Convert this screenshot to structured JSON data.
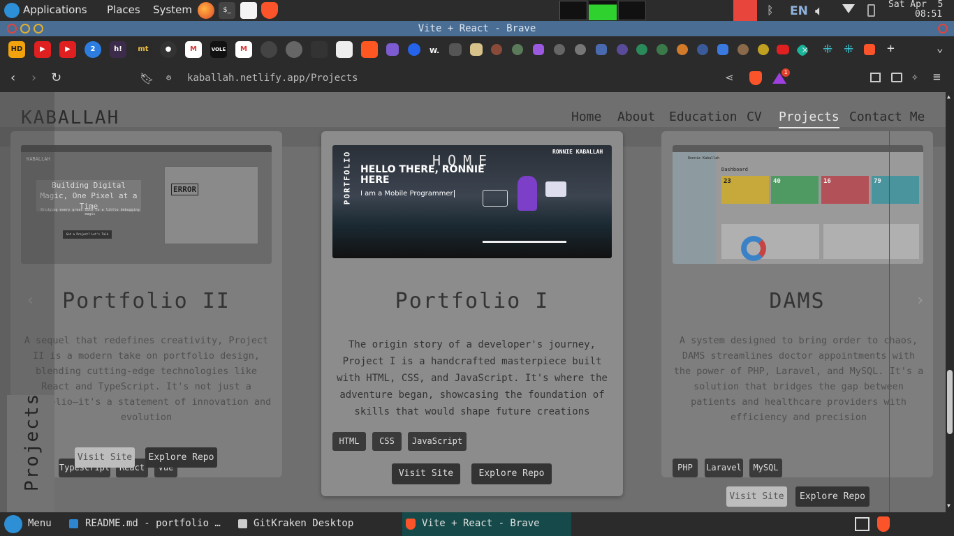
{
  "top_panel": {
    "menus": [
      "Applications",
      "Places",
      "System"
    ],
    "keyboard_layout": "EN",
    "clock_date": "Sat Apr  5",
    "clock_time": "08:51"
  },
  "window": {
    "title": "Vite + React - Brave"
  },
  "tabs": [
    {
      "label": "HD",
      "color": "#f2a20c"
    },
    {
      "label": "",
      "color": "#e02020",
      "icon": "youtube-icon"
    },
    {
      "label": "",
      "color": "#e02020",
      "icon": "youtube-icon"
    },
    {
      "label": "2",
      "color": "#2d7de0"
    },
    {
      "label": "h!",
      "color": "#3c2b4a"
    },
    {
      "label": "mt",
      "color": "#2a2a2a"
    },
    {
      "label": "",
      "color": "#333",
      "icon": "github-icon"
    },
    {
      "label": "M",
      "color": "#fff",
      "icon": "gmail-icon"
    },
    {
      "label": "VOLE",
      "color": "#111"
    },
    {
      "label": "M",
      "color": "#fff",
      "icon": "gmail-icon"
    }
  ],
  "address_bar": {
    "url": "kaballah.netlify.app/Projects",
    "notification_count": "1"
  },
  "site": {
    "logo": "KABALLAH",
    "nav": [
      "Home",
      "About",
      "Education",
      "CV",
      "Projects",
      "Contact Me"
    ],
    "active_nav": "Projects",
    "side_label": "Projects"
  },
  "projects": [
    {
      "title": "Portfolio II",
      "description": "A sequel that redefines creativity, Project II is a modern take on portfolio design, blending cutting-edge technologies like React and TypeScript. It's not just a portfolio—it's a statement of innovation and evolution",
      "tags": [
        "Typescript",
        "React",
        "Vue"
      ],
      "visit_label": "Visit Site",
      "repo_label": "Explore Repo",
      "thumb_logo": "KABALLAH",
      "thumb_heading": "Building Digital Magic, One Pixel at a Time",
      "thumb_sub": "Bridging every great site to a little debugging magic",
      "thumb_error": "ERROR",
      "thumb_btn": "Got a Project? Let's Talk"
    },
    {
      "title": "Portfolio I",
      "description": "The origin story of a developer's journey, Project I is a handcrafted masterpiece built with HTML, CSS, and JavaScript. It's where the adventure began, showcasing the foundation of skills that would shape future creations",
      "tags": [
        "HTML",
        "CSS",
        "JavaScript"
      ],
      "visit_label": "Visit Site",
      "repo_label": "Explore Repo",
      "thumb_home": "HOME",
      "thumb_name": "RONNIE KABALLAH",
      "thumb_hello": "HELLO THERE, RONNIE HERE",
      "thumb_role": "I am a Mobile Programmer",
      "thumb_side": "PORTFOLIO"
    },
    {
      "title": "DAMS",
      "description": "A system designed to bring order to chaos, DAMS streamlines doctor appointments with the power of PHP, Laravel, and MySQL. It's a solution that bridges the gap between patients and healthcare providers with efficiency and precision",
      "tags": [
        "PHP",
        "Laravel",
        "MySQL"
      ],
      "visit_label": "Visit Site",
      "repo_label": "Explore Repo",
      "thumb_user": "Ronnie Kaballah",
      "thumb_heading": "Dashboard",
      "thumb_stats": [
        {
          "value": "23",
          "color": "#f0c030"
        },
        {
          "value": "40",
          "color": "#3cae5c"
        },
        {
          "value": "16",
          "color": "#d9414f"
        },
        {
          "value": "79",
          "color": "#2aa7b8"
        }
      ],
      "thumb_sidebar": [
        "Dashboard",
        "Appointments",
        "Users",
        "Specialization",
        "Test Types",
        "Reports",
        "Logout"
      ]
    }
  ],
  "taskbar": {
    "menu_label": "Menu",
    "items": [
      "README.md - portfolio …",
      "GitKraken Desktop",
      "Vite + React - Brave"
    ]
  }
}
